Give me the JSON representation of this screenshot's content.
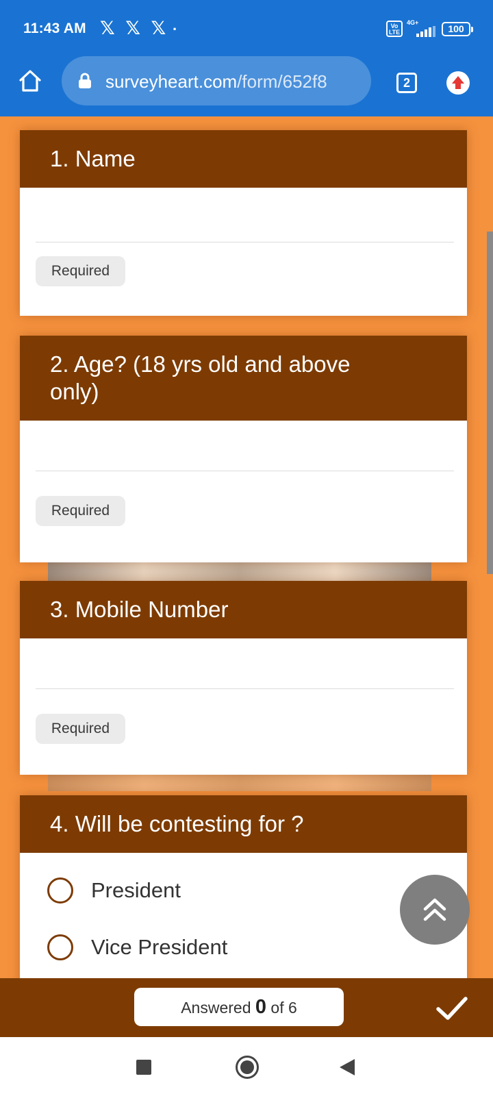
{
  "status_bar": {
    "time": "11:43 AM",
    "notification_icons": "𝕏 𝕏 𝕏",
    "dot": "·",
    "volte": "Vo LTE",
    "network": "4G+",
    "battery": "100"
  },
  "browser": {
    "url_host": "surveyheart.com",
    "url_path": "/form/652f8",
    "tab_count": "2"
  },
  "form": {
    "questions": [
      {
        "title": "1. Name",
        "required_label": "Required"
      },
      {
        "title": "2. Age? (18 yrs old and above only)",
        "required_label": "Required"
      },
      {
        "title": "3. Mobile Number",
        "required_label": "Required"
      },
      {
        "title": "4. Will be contesting for ?",
        "options": [
          "President",
          "Vice President"
        ]
      }
    ]
  },
  "footer": {
    "answered_prefix": "Answered",
    "answered_count": "0",
    "answered_suffix": "of 6"
  },
  "colors": {
    "browser_blue": "#1a73d2",
    "form_orange": "#f5923e",
    "header_brown": "#7d3b03"
  }
}
